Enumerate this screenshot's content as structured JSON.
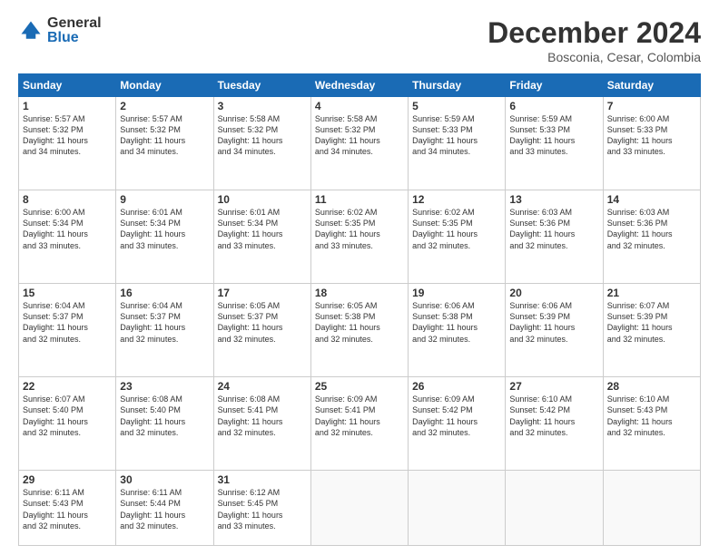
{
  "logo": {
    "general": "General",
    "blue": "Blue"
  },
  "title": "December 2024",
  "location": "Bosconia, Cesar, Colombia",
  "days_of_week": [
    "Sunday",
    "Monday",
    "Tuesday",
    "Wednesday",
    "Thursday",
    "Friday",
    "Saturday"
  ],
  "weeks": [
    [
      {
        "day": "1",
        "info": "Sunrise: 5:57 AM\nSunset: 5:32 PM\nDaylight: 11 hours\nand 34 minutes."
      },
      {
        "day": "2",
        "info": "Sunrise: 5:57 AM\nSunset: 5:32 PM\nDaylight: 11 hours\nand 34 minutes."
      },
      {
        "day": "3",
        "info": "Sunrise: 5:58 AM\nSunset: 5:32 PM\nDaylight: 11 hours\nand 34 minutes."
      },
      {
        "day": "4",
        "info": "Sunrise: 5:58 AM\nSunset: 5:32 PM\nDaylight: 11 hours\nand 34 minutes."
      },
      {
        "day": "5",
        "info": "Sunrise: 5:59 AM\nSunset: 5:33 PM\nDaylight: 11 hours\nand 34 minutes."
      },
      {
        "day": "6",
        "info": "Sunrise: 5:59 AM\nSunset: 5:33 PM\nDaylight: 11 hours\nand 33 minutes."
      },
      {
        "day": "7",
        "info": "Sunrise: 6:00 AM\nSunset: 5:33 PM\nDaylight: 11 hours\nand 33 minutes."
      }
    ],
    [
      {
        "day": "8",
        "info": "Sunrise: 6:00 AM\nSunset: 5:34 PM\nDaylight: 11 hours\nand 33 minutes."
      },
      {
        "day": "9",
        "info": "Sunrise: 6:01 AM\nSunset: 5:34 PM\nDaylight: 11 hours\nand 33 minutes."
      },
      {
        "day": "10",
        "info": "Sunrise: 6:01 AM\nSunset: 5:34 PM\nDaylight: 11 hours\nand 33 minutes."
      },
      {
        "day": "11",
        "info": "Sunrise: 6:02 AM\nSunset: 5:35 PM\nDaylight: 11 hours\nand 33 minutes."
      },
      {
        "day": "12",
        "info": "Sunrise: 6:02 AM\nSunset: 5:35 PM\nDaylight: 11 hours\nand 32 minutes."
      },
      {
        "day": "13",
        "info": "Sunrise: 6:03 AM\nSunset: 5:36 PM\nDaylight: 11 hours\nand 32 minutes."
      },
      {
        "day": "14",
        "info": "Sunrise: 6:03 AM\nSunset: 5:36 PM\nDaylight: 11 hours\nand 32 minutes."
      }
    ],
    [
      {
        "day": "15",
        "info": "Sunrise: 6:04 AM\nSunset: 5:37 PM\nDaylight: 11 hours\nand 32 minutes."
      },
      {
        "day": "16",
        "info": "Sunrise: 6:04 AM\nSunset: 5:37 PM\nDaylight: 11 hours\nand 32 minutes."
      },
      {
        "day": "17",
        "info": "Sunrise: 6:05 AM\nSunset: 5:37 PM\nDaylight: 11 hours\nand 32 minutes."
      },
      {
        "day": "18",
        "info": "Sunrise: 6:05 AM\nSunset: 5:38 PM\nDaylight: 11 hours\nand 32 minutes."
      },
      {
        "day": "19",
        "info": "Sunrise: 6:06 AM\nSunset: 5:38 PM\nDaylight: 11 hours\nand 32 minutes."
      },
      {
        "day": "20",
        "info": "Sunrise: 6:06 AM\nSunset: 5:39 PM\nDaylight: 11 hours\nand 32 minutes."
      },
      {
        "day": "21",
        "info": "Sunrise: 6:07 AM\nSunset: 5:39 PM\nDaylight: 11 hours\nand 32 minutes."
      }
    ],
    [
      {
        "day": "22",
        "info": "Sunrise: 6:07 AM\nSunset: 5:40 PM\nDaylight: 11 hours\nand 32 minutes."
      },
      {
        "day": "23",
        "info": "Sunrise: 6:08 AM\nSunset: 5:40 PM\nDaylight: 11 hours\nand 32 minutes."
      },
      {
        "day": "24",
        "info": "Sunrise: 6:08 AM\nSunset: 5:41 PM\nDaylight: 11 hours\nand 32 minutes."
      },
      {
        "day": "25",
        "info": "Sunrise: 6:09 AM\nSunset: 5:41 PM\nDaylight: 11 hours\nand 32 minutes."
      },
      {
        "day": "26",
        "info": "Sunrise: 6:09 AM\nSunset: 5:42 PM\nDaylight: 11 hours\nand 32 minutes."
      },
      {
        "day": "27",
        "info": "Sunrise: 6:10 AM\nSunset: 5:42 PM\nDaylight: 11 hours\nand 32 minutes."
      },
      {
        "day": "28",
        "info": "Sunrise: 6:10 AM\nSunset: 5:43 PM\nDaylight: 11 hours\nand 32 minutes."
      }
    ],
    [
      {
        "day": "29",
        "info": "Sunrise: 6:11 AM\nSunset: 5:43 PM\nDaylight: 11 hours\nand 32 minutes."
      },
      {
        "day": "30",
        "info": "Sunrise: 6:11 AM\nSunset: 5:44 PM\nDaylight: 11 hours\nand 32 minutes."
      },
      {
        "day": "31",
        "info": "Sunrise: 6:12 AM\nSunset: 5:45 PM\nDaylight: 11 hours\nand 33 minutes."
      },
      {
        "day": "",
        "info": ""
      },
      {
        "day": "",
        "info": ""
      },
      {
        "day": "",
        "info": ""
      },
      {
        "day": "",
        "info": ""
      }
    ]
  ]
}
